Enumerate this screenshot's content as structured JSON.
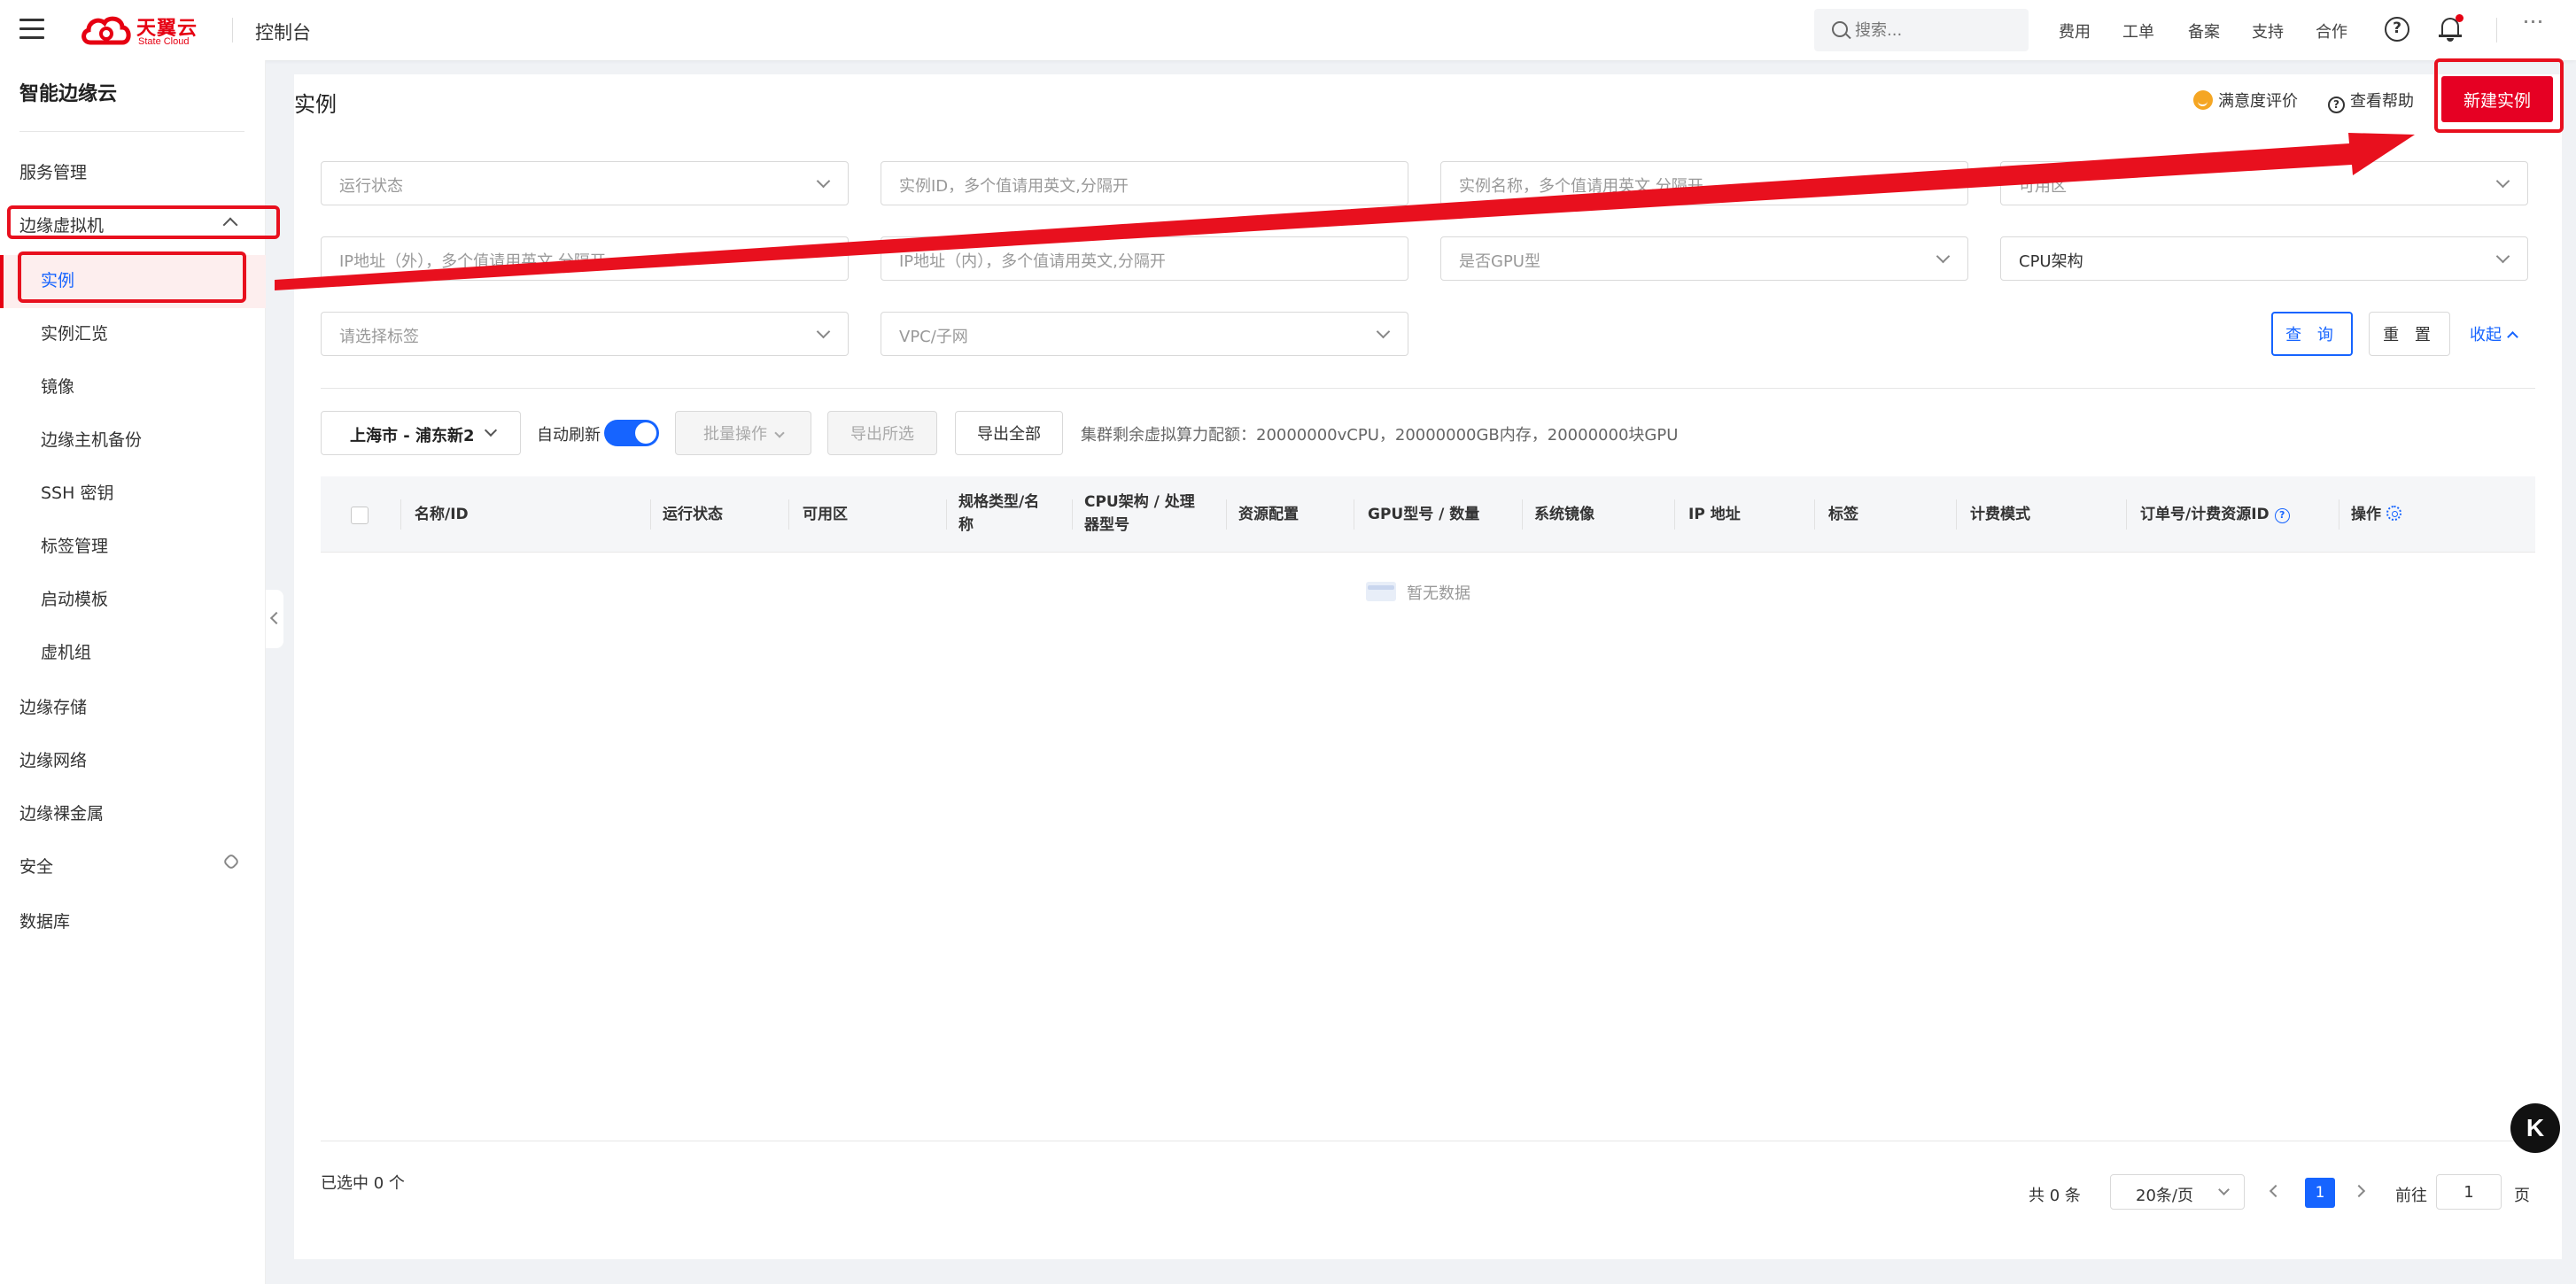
{
  "topbar": {
    "logo_cn": "天翼云",
    "logo_en": "State Cloud",
    "console_title": "控制台",
    "search_placeholder": "搜索...",
    "nav": [
      "费用",
      "工单",
      "备案",
      "支持",
      "合作"
    ],
    "help_glyph": "?"
  },
  "sidebar": {
    "title": "智能边缘云",
    "items": [
      {
        "label": "服务管理"
      },
      {
        "label": "边缘虚拟机"
      },
      {
        "label": "实例"
      },
      {
        "label": "实例汇览"
      },
      {
        "label": "镜像"
      },
      {
        "label": "边缘主机备份"
      },
      {
        "label": "SSH 密钥"
      },
      {
        "label": "标签管理"
      },
      {
        "label": "启动模板"
      },
      {
        "label": "虚机组"
      },
      {
        "label": "边缘存储"
      },
      {
        "label": "边缘网络"
      },
      {
        "label": "边缘裸金属"
      },
      {
        "label": "安全"
      },
      {
        "label": "数据库"
      }
    ]
  },
  "header": {
    "title": "实例",
    "satisfaction": "满意度评价",
    "help": "查看帮助",
    "new_button": "新建实例"
  },
  "filters": {
    "status": "运行状态",
    "instance_id": "实例ID，多个值请用英文,分隔开",
    "instance_name": "实例名称，多个值请用英文,分隔开",
    "zone": "可用区",
    "ip_public": "IP地址（外），多个值请用英文,分隔开",
    "ip_private": "IP地址（内），多个值请用英文,分隔开",
    "gpu": "是否GPU型",
    "cpu_arch": "CPU架构",
    "tags": "请选择标签",
    "vpc": "VPC/子网",
    "query": "查 询",
    "reset": "重 置",
    "collapse": "收起"
  },
  "toolbar": {
    "region": "上海市 - 浦东新2",
    "auto_refresh": "自动刷新",
    "auto_refresh_on": true,
    "batch": "批量操作",
    "export_selected": "导出所选",
    "export_all": "导出全部",
    "quota": "集群剩余虚拟算力配额：20000000vCPU，20000000GB内存，20000000块GPU"
  },
  "table": {
    "columns": [
      "名称/ID",
      "运行状态",
      "可用区",
      "规格类型/名称",
      "CPU架构 / 处理器型号",
      "资源配置",
      "GPU型号 / 数量",
      "系统镜像",
      "IP 地址",
      "标签",
      "计费模式",
      "订单号/计费资源ID",
      "操作"
    ],
    "col_lines": {
      "spec_line1": "规格类型/名",
      "spec_line2": "称",
      "cpu_line1": "CPU架构 / 处理",
      "cpu_line2": "器型号"
    },
    "empty": "暂无数据"
  },
  "footer": {
    "selected": "已选中 0 个",
    "total": "共 0 条",
    "page_size": "20条/页",
    "current_page": "1",
    "goto_label": "前往",
    "goto_value": "1",
    "goto_suffix": "页"
  },
  "float_button": "K",
  "colors": {
    "brand_red": "#e60012",
    "primary_blue": "#1664ff",
    "annotation_red": "#e8101e"
  }
}
